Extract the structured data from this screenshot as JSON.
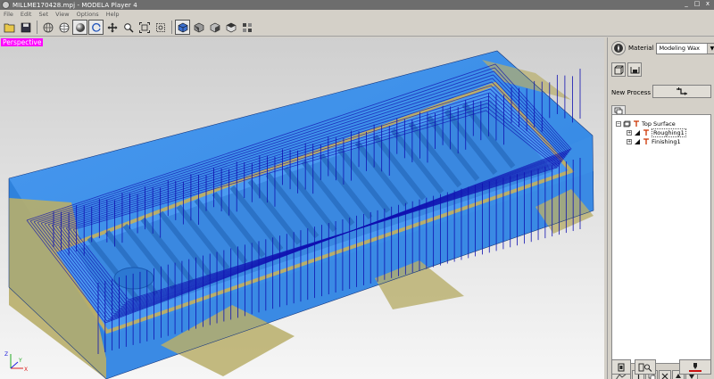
{
  "window": {
    "title": "MILLME170428.mpj - MODELA Player 4",
    "controls": [
      "_",
      "□",
      "x"
    ]
  },
  "menu": [
    "File",
    "Edit",
    "Set",
    "View",
    "Options",
    "Help"
  ],
  "view": {
    "label": "Perspective"
  },
  "axis": {
    "x": "X",
    "y": "Y",
    "z": "Z"
  },
  "panel": {
    "material_label": "Material",
    "material_value": "Modeling Wax",
    "new_process_label": "New Process",
    "tree": {
      "root": "Top Surface",
      "children": [
        "Roughing1",
        "Finishing1"
      ]
    }
  },
  "colors": {
    "model_blue": "#3b8fe8",
    "model_wall": "#b8ae6a",
    "toolpath": "#1010b0",
    "highlight": "#ff00ff"
  }
}
